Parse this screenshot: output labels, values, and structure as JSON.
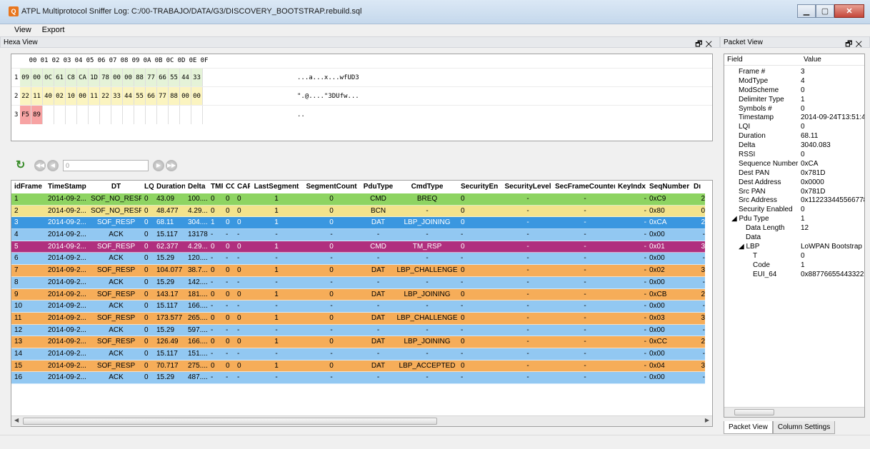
{
  "window": {
    "title": "ATPL Multiprotocol Sniffer Log: C:/00-TRABAJO/DATA/G3/DISCOVERY_BOOTSTRAP.rebuild.sql",
    "app_icon": "Q"
  },
  "menu": [
    {
      "label": "View"
    },
    {
      "label": "Export"
    }
  ],
  "hexa_view": {
    "title": "Hexa View",
    "columns": [
      "00",
      "01",
      "02",
      "03",
      "04",
      "05",
      "06",
      "07",
      "08",
      "09",
      "0A",
      "0B",
      "0C",
      "0D",
      "0E",
      "0F"
    ],
    "rows": [
      {
        "num": "1",
        "bytes": [
          "09",
          "00",
          "0C",
          "61",
          "C8",
          "CA",
          "1D",
          "78",
          "00",
          "00",
          "88",
          "77",
          "66",
          "55",
          "44",
          "33"
        ],
        "ascii": "...a...x...wfUD3"
      },
      {
        "num": "2",
        "bytes": [
          "22",
          "11",
          "40",
          "02",
          "10",
          "00",
          "11",
          "22",
          "33",
          "44",
          "55",
          "66",
          "77",
          "88",
          "00",
          "00"
        ],
        "ascii": "\".@....\"3DUfw..."
      },
      {
        "num": "3",
        "bytes": [
          "F5",
          "89",
          "",
          "",
          "",
          "",
          "",
          "",
          "",
          "",
          "",
          "",
          "",
          "",
          "",
          ""
        ],
        "ascii": ".."
      }
    ],
    "colors": {
      "row1": "#e5f3d8",
      "row2": "#fbf4c0",
      "row3": "#f7a3a3"
    }
  },
  "navigator": {
    "refresh_icon": "refresh-icon",
    "input_value": "0"
  },
  "table": {
    "columns": [
      "idFrame",
      "TimeStamp",
      "DT",
      "LQI",
      "Duration",
      "Delta",
      "TMR",
      "CC",
      "CAP",
      "LastSegment",
      "SegmentCount",
      "PduType",
      "CmdType",
      "SecurityEn",
      "SecurityLevel",
      "SecFrameCounter",
      "KeyIndx",
      "SeqNumber",
      "Dı"
    ],
    "rows": [
      {
        "color": "#8ed462",
        "cells": [
          "1",
          "2014-09-2...",
          "SOF_NO_RESP",
          "0",
          "43.09",
          "100....",
          "0",
          "0",
          "0",
          "1",
          "0",
          "CMD",
          "BREQ",
          "0",
          "-",
          "-",
          "-",
          "0xC9",
          "2"
        ]
      },
      {
        "color": "#f3e38c",
        "cells": [
          "2",
          "2014-09-2...",
          "SOF_NO_RESP",
          "0",
          "48.477",
          "4.29...",
          "0",
          "0",
          "0",
          "1",
          "0",
          "BCN",
          "-",
          "0",
          "-",
          "-",
          "-",
          "0x80",
          "0"
        ]
      },
      {
        "color": "#3a97e0",
        "cells": [
          "3",
          "2014-09-2...",
          "SOF_RESP",
          "0",
          "68.11",
          "304....",
          "1",
          "0",
          "0",
          "1",
          "0",
          "DAT",
          "LBP_JOINING",
          "0",
          "-",
          "-",
          "-",
          "0xCA",
          "2"
        ],
        "selected": true
      },
      {
        "color": "#92c8f2",
        "cells": [
          "4",
          "2014-09-2...",
          "ACK",
          "0",
          "15.117",
          "13178",
          "-",
          "-",
          "-",
          "-",
          "-",
          "-",
          "-",
          "-",
          "-",
          "-",
          "-",
          "0x00",
          "-"
        ]
      },
      {
        "color": "#b02f7e",
        "cells": [
          "5",
          "2014-09-2...",
          "SOF_RESP",
          "0",
          "62.377",
          "4.29...",
          "0",
          "0",
          "0",
          "1",
          "0",
          "CMD",
          "TM_RSP",
          "0",
          "-",
          "-",
          "-",
          "0x01",
          "3"
        ]
      },
      {
        "color": "#92c8f2",
        "cells": [
          "6",
          "2014-09-2...",
          "ACK",
          "0",
          "15.29",
          "120....",
          "-",
          "-",
          "-",
          "-",
          "-",
          "-",
          "-",
          "-",
          "-",
          "-",
          "-",
          "0x00",
          "-"
        ]
      },
      {
        "color": "#f6ad59",
        "cells": [
          "7",
          "2014-09-2...",
          "SOF_RESP",
          "0",
          "104.077",
          "38.7...",
          "0",
          "0",
          "0",
          "1",
          "0",
          "DAT",
          "LBP_CHALLENGE",
          "0",
          "-",
          "-",
          "-",
          "0x02",
          "3"
        ]
      },
      {
        "color": "#92c8f2",
        "cells": [
          "8",
          "2014-09-2...",
          "ACK",
          "0",
          "15.29",
          "142....",
          "-",
          "-",
          "-",
          "-",
          "-",
          "-",
          "-",
          "-",
          "-",
          "-",
          "-",
          "0x00",
          "-"
        ]
      },
      {
        "color": "#f6ad59",
        "cells": [
          "9",
          "2014-09-2...",
          "SOF_RESP",
          "0",
          "143.17",
          "181....",
          "0",
          "0",
          "0",
          "1",
          "0",
          "DAT",
          "LBP_JOINING",
          "0",
          "-",
          "-",
          "-",
          "0xCB",
          "2"
        ]
      },
      {
        "color": "#92c8f2",
        "cells": [
          "10",
          "2014-09-2...",
          "ACK",
          "0",
          "15.117",
          "166....",
          "-",
          "-",
          "-",
          "-",
          "-",
          "-",
          "-",
          "-",
          "-",
          "-",
          "-",
          "0x00",
          "-"
        ]
      },
      {
        "color": "#f6ad59",
        "cells": [
          "11",
          "2014-09-2...",
          "SOF_RESP",
          "0",
          "173.577",
          "265....",
          "0",
          "0",
          "0",
          "1",
          "0",
          "DAT",
          "LBP_CHALLENGE",
          "0",
          "-",
          "-",
          "-",
          "0x03",
          "3"
        ]
      },
      {
        "color": "#92c8f2",
        "cells": [
          "12",
          "2014-09-2...",
          "ACK",
          "0",
          "15.29",
          "597....",
          "-",
          "-",
          "-",
          "-",
          "-",
          "-",
          "-",
          "-",
          "-",
          "-",
          "-",
          "0x00",
          "-"
        ]
      },
      {
        "color": "#f6ad59",
        "cells": [
          "13",
          "2014-09-2...",
          "SOF_RESP",
          "0",
          "126.49",
          "166....",
          "0",
          "0",
          "0",
          "1",
          "0",
          "DAT",
          "LBP_JOINING",
          "0",
          "-",
          "-",
          "-",
          "0xCC",
          "2"
        ]
      },
      {
        "color": "#92c8f2",
        "cells": [
          "14",
          "2014-09-2...",
          "ACK",
          "0",
          "15.117",
          "151....",
          "-",
          "-",
          "-",
          "-",
          "-",
          "-",
          "-",
          "-",
          "-",
          "-",
          "-",
          "0x00",
          "-"
        ]
      },
      {
        "color": "#f6ad59",
        "cells": [
          "15",
          "2014-09-2...",
          "SOF_RESP",
          "0",
          "70.717",
          "275....",
          "0",
          "0",
          "0",
          "1",
          "0",
          "DAT",
          "LBP_ACCEPTED",
          "0",
          "-",
          "-",
          "-",
          "0x04",
          "3"
        ]
      },
      {
        "color": "#92c8f2",
        "cells": [
          "16",
          "2014-09-2...",
          "ACK",
          "0",
          "15.29",
          "487....",
          "-",
          "-",
          "-",
          "-",
          "-",
          "-",
          "-",
          "-",
          "-",
          "-",
          "-",
          "0x00",
          "-"
        ]
      }
    ],
    "scroll_marker": "III"
  },
  "packet_view": {
    "title": "Packet View",
    "field_header": "Field",
    "value_header": "Value",
    "rows": [
      {
        "field": "Frame #",
        "value": "3",
        "indent": 1
      },
      {
        "field": "ModType",
        "value": "4",
        "indent": 1
      },
      {
        "field": "ModScheme",
        "value": "0",
        "indent": 1
      },
      {
        "field": "Delimiter Type",
        "value": "1",
        "indent": 1
      },
      {
        "field": "Symbols #",
        "value": "0",
        "indent": 1
      },
      {
        "field": "Timestamp",
        "value": "2014-09-24T13:51:4",
        "indent": 1
      },
      {
        "field": "LQI",
        "value": "0",
        "indent": 1
      },
      {
        "field": "Duration",
        "value": "68.11",
        "indent": 1
      },
      {
        "field": "Delta",
        "value": "3040.083",
        "indent": 1
      },
      {
        "field": "RSSI",
        "value": "0",
        "indent": 1
      },
      {
        "field": "Sequence Number",
        "value": "0xCA",
        "indent": 1
      },
      {
        "field": "Dest PAN",
        "value": "0x781D",
        "indent": 1
      },
      {
        "field": "Dest Address",
        "value": "0x0000",
        "indent": 1
      },
      {
        "field": "Src PAN",
        "value": "0x781D",
        "indent": 1
      },
      {
        "field": "Src Address",
        "value": "0x112233445566778",
        "indent": 1
      },
      {
        "field": "Security Enabled",
        "value": "0",
        "indent": 1
      },
      {
        "field": "◢  Pdu Type",
        "value": "1",
        "indent": 0
      },
      {
        "field": "Data Length",
        "value": "12",
        "indent": 2
      },
      {
        "field": "Data",
        "value": "",
        "indent": 2
      },
      {
        "field": "◢  LBP",
        "value": "LoWPAN Bootstrap",
        "indent": 1
      },
      {
        "field": "T",
        "value": "0",
        "indent": 3
      },
      {
        "field": "Code",
        "value": "1",
        "indent": 3
      },
      {
        "field": "EUI_64",
        "value": "0x887766554433221",
        "indent": 3
      }
    ],
    "tabs": [
      {
        "label": "Packet View"
      },
      {
        "label": "Column Settings"
      }
    ],
    "scroll_marker": "III"
  }
}
